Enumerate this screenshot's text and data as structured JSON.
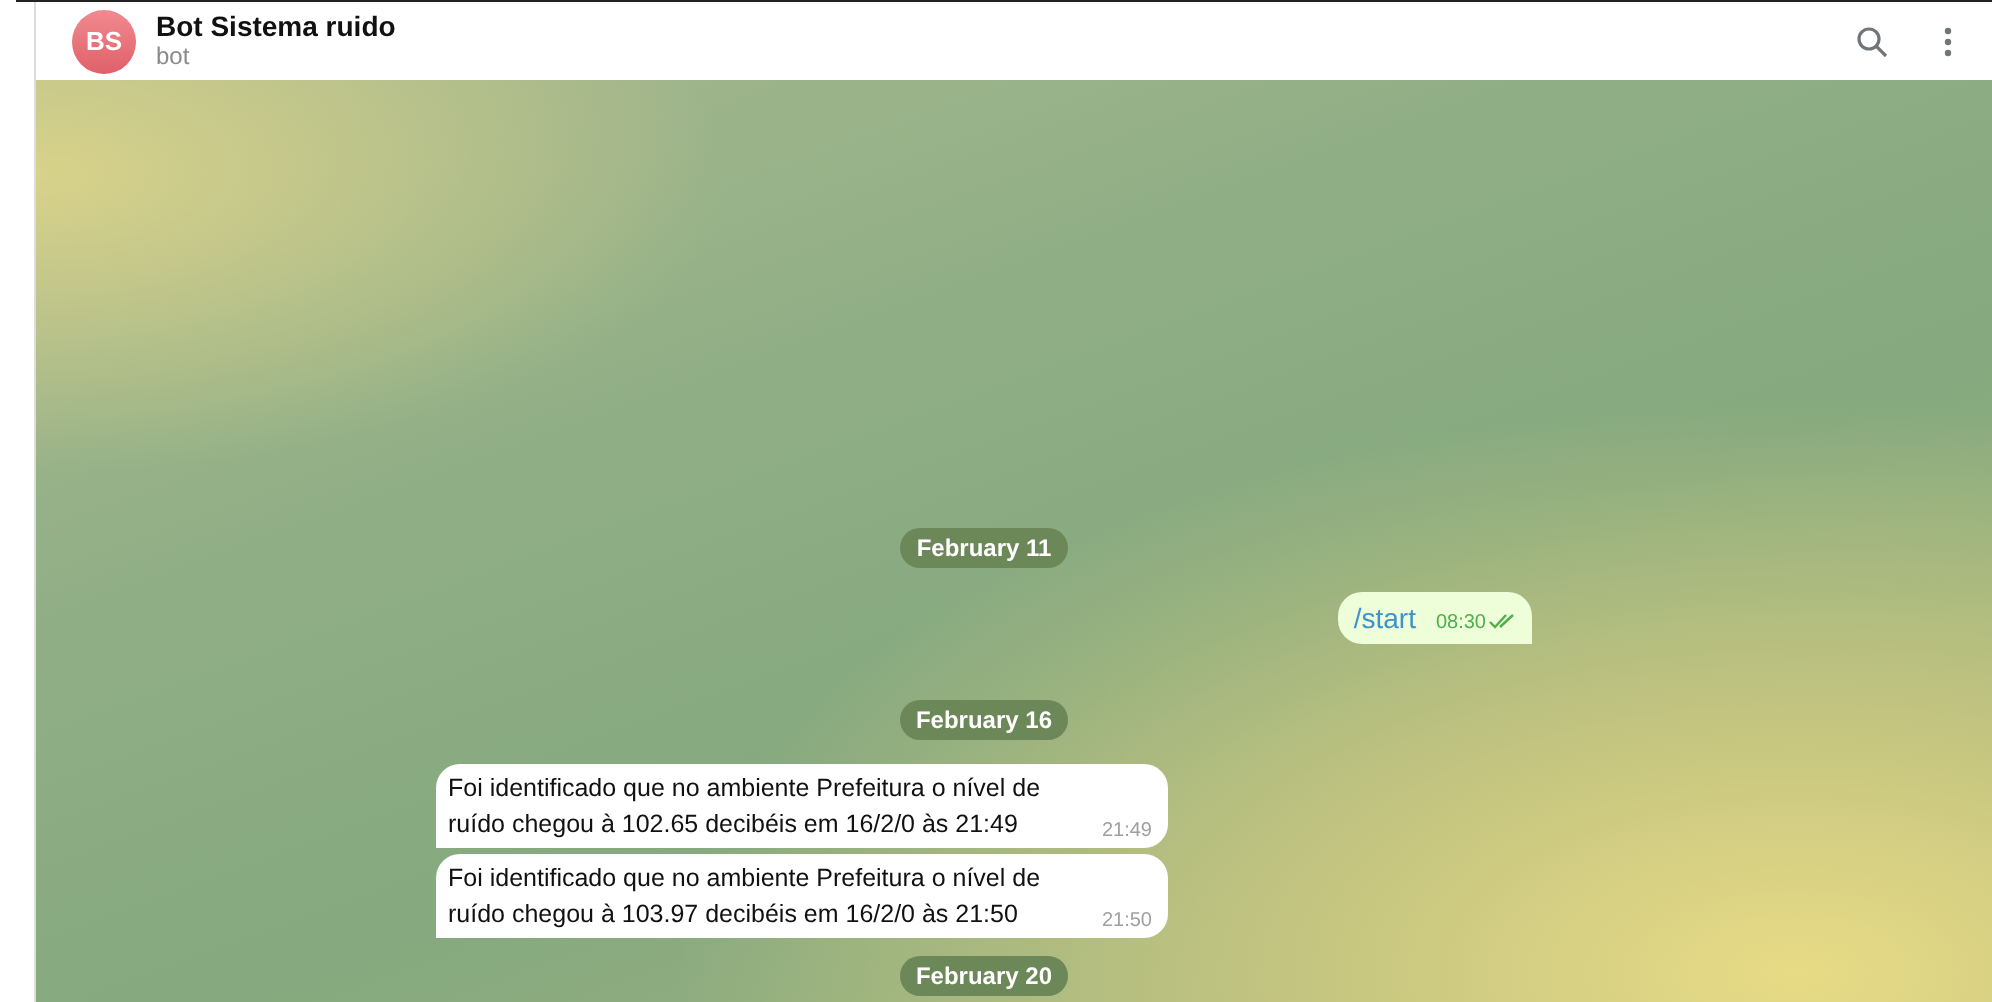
{
  "header": {
    "avatar": "BS",
    "title": "Bot Sistema ruido",
    "subtitle": "bot"
  },
  "messages": [
    {
      "kind": "date",
      "text": "February 11"
    },
    {
      "kind": "outgoing",
      "text": "/start",
      "time": "08:30",
      "read": true
    },
    {
      "kind": "date",
      "text": "February 16"
    },
    {
      "kind": "incoming",
      "text": "Foi identificado que no ambiente Prefeitura o nível de ruído chegou à 102.65 decibéis em 16/2/0 às 21:49",
      "time": "21:49"
    },
    {
      "kind": "incoming",
      "text": "Foi identificado que no ambiente Prefeitura o nível de ruído chegou à 103.97 decibéis em 16/2/0 às 21:50",
      "time": "21:50"
    },
    {
      "kind": "date",
      "text": "February 20"
    }
  ]
}
